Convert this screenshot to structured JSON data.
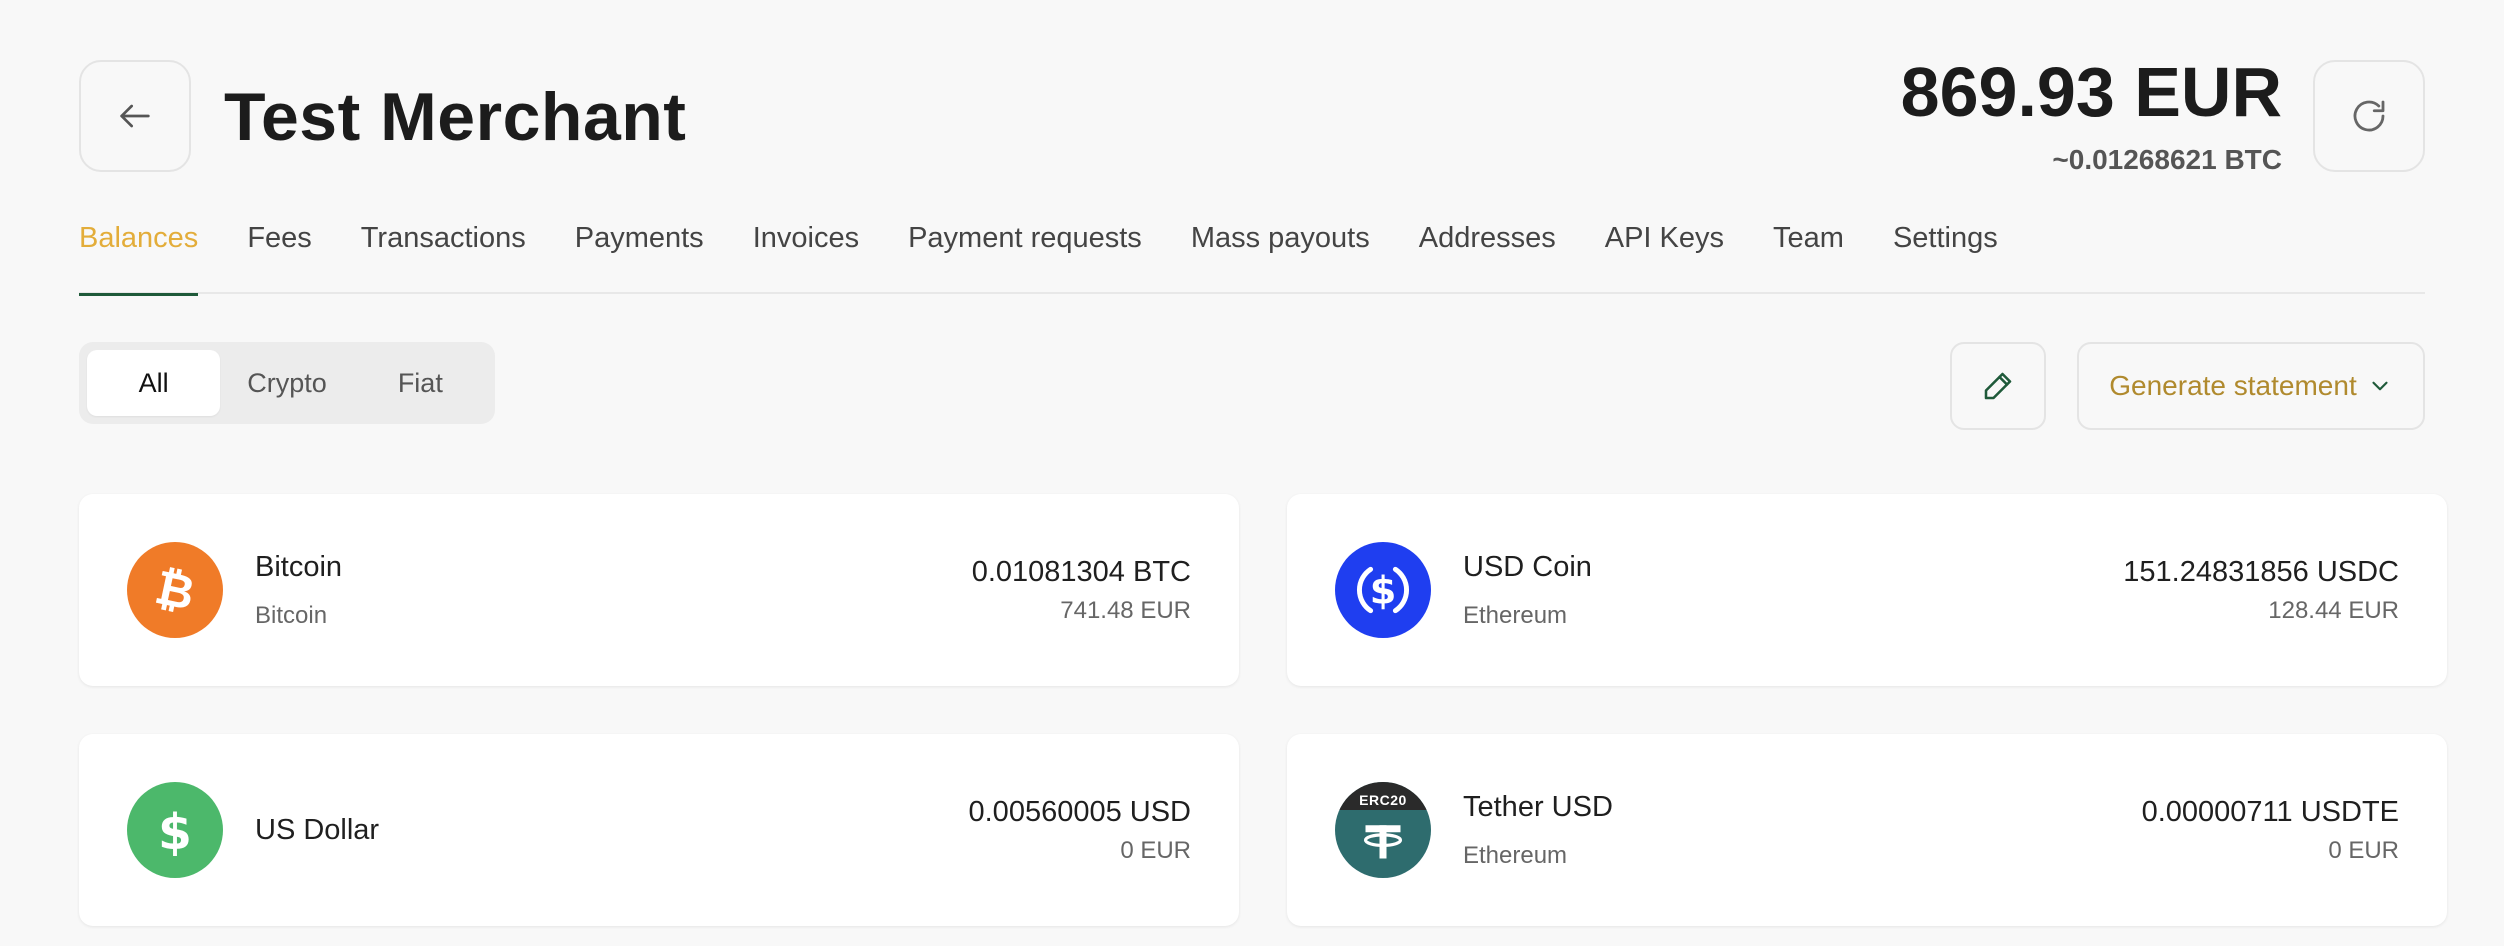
{
  "header": {
    "title": "Test Merchant",
    "balance_main": "869.93 EUR",
    "balance_sub": "~0.01268621 BTC"
  },
  "tabs": [
    {
      "label": "Balances",
      "active": true
    },
    {
      "label": "Fees"
    },
    {
      "label": "Transactions"
    },
    {
      "label": "Payments"
    },
    {
      "label": "Invoices"
    },
    {
      "label": "Payment requests"
    },
    {
      "label": "Mass payouts"
    },
    {
      "label": "Addresses"
    },
    {
      "label": "API Keys"
    },
    {
      "label": "Team"
    },
    {
      "label": "Settings"
    }
  ],
  "filter": {
    "options": [
      "All",
      "Crypto",
      "Fiat"
    ],
    "selected": "All"
  },
  "toolbar": {
    "generate_label": "Generate statement"
  },
  "balances": [
    {
      "name": "Bitcoin",
      "network": "Bitcoin",
      "amount": "0.01081304 BTC",
      "fiat": "741.48 EUR",
      "icon": "bitcoin-icon",
      "color": "#f07b28"
    },
    {
      "name": "USD Coin",
      "network": "Ethereum",
      "amount": "151.24831856 USDC",
      "fiat": "128.44 EUR",
      "icon": "usdc-icon",
      "color": "#1f3ef0"
    },
    {
      "name": "US Dollar",
      "network": "",
      "amount": "0.00560005 USD",
      "fiat": "0 EUR",
      "icon": "dollar-icon",
      "color": "#4cb86b"
    },
    {
      "name": "Tether USD",
      "network": "Ethereum",
      "amount": "0.00000711 USDTE",
      "fiat": "0 EUR",
      "icon": "tether-icon",
      "color": "#2e6c6e",
      "tag": "ERC20"
    }
  ],
  "colors": {
    "accent": "#e3ad3a",
    "tab_underline": "#1f5a3a",
    "generate_text": "#b08a2e"
  }
}
